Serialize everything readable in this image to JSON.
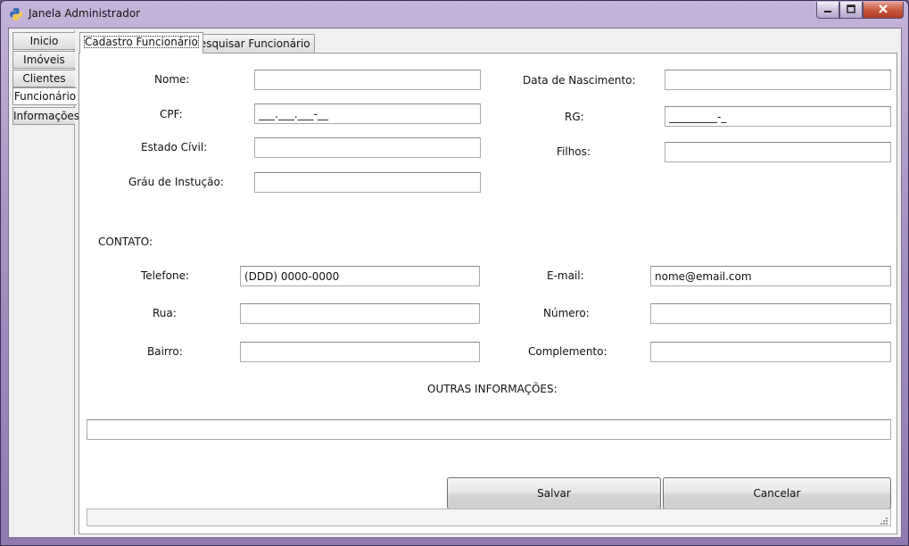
{
  "window": {
    "title": "Janela Administrador",
    "icon": "python-icon",
    "controls": [
      "minimize-icon",
      "maximize-icon",
      "close-icon"
    ]
  },
  "sidebar": {
    "items": [
      {
        "label": "Inicio"
      },
      {
        "label": "Imóveis"
      },
      {
        "label": "Clientes"
      },
      {
        "label": "Funcionário",
        "active": true
      },
      {
        "label": "Informações"
      }
    ]
  },
  "tabs": [
    {
      "label": "Cadastro Funcionário",
      "active": true
    },
    {
      "label": "Pesquisar Funcionário"
    }
  ],
  "form": {
    "nome": {
      "label": "Nome:",
      "value": ""
    },
    "data_nascimento": {
      "label": "Data de Nascimento:",
      "value": ""
    },
    "cpf": {
      "label": "CPF:",
      "value": "___.___.___-__"
    },
    "rg": {
      "label": "RG:",
      "value": "_________-_"
    },
    "estado_civil": {
      "label": "Estado Cívil:",
      "value": ""
    },
    "filhos": {
      "label": "Filhos:",
      "value": ""
    },
    "grau_instrucao": {
      "label": "Gráu de Instução:",
      "value": ""
    },
    "contato_heading": "CONTATO:",
    "telefone": {
      "label": "Telefone:",
      "value": "(DDD) 0000-0000"
    },
    "email": {
      "label": "E-mail:",
      "value": "nome@email.com"
    },
    "rua": {
      "label": "Rua:",
      "value": ""
    },
    "numero": {
      "label": "Número:",
      "value": ""
    },
    "bairro": {
      "label": "Bairro:",
      "value": ""
    },
    "complemento": {
      "label": "Complemento:",
      "value": ""
    },
    "outras_heading": "OUTRAS INFORMAÇÕES:",
    "outras": {
      "value": ""
    }
  },
  "buttons": {
    "save_label": "Salvar",
    "cancel_label": "Cancelar"
  },
  "status": {
    "text": ""
  }
}
